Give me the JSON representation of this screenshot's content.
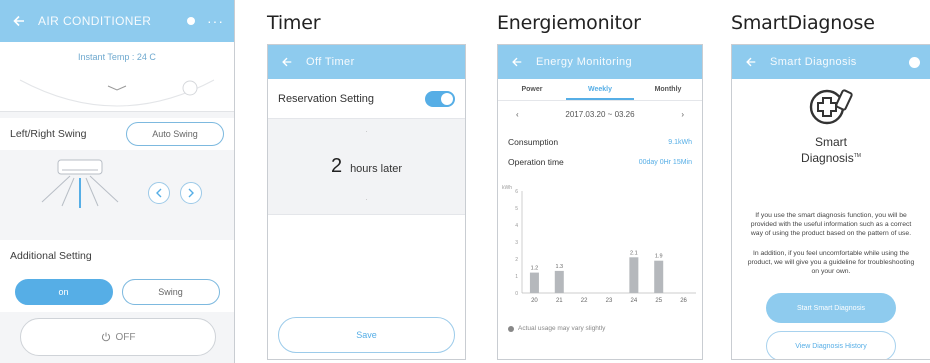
{
  "captions": {
    "timer": "Timer",
    "energy": "Energiemonitor",
    "smart": "SmartDiagnose"
  },
  "colors": {
    "accent": "#56aee6",
    "appbar": "#8ecbee"
  },
  "screen_ac": {
    "title": "AIR CONDITIONER",
    "instant_temp": "Instant Temp : 24 C",
    "swing_label": "Left/Right Swing",
    "auto_swing": "Auto Swing",
    "additional": "Additional Setting",
    "btn_on": "on",
    "btn_swing": "Swing",
    "off": "OFF"
  },
  "screen_timer": {
    "title": "Off Timer",
    "reservation": "Reservation Setting",
    "value": "2",
    "unit": "hours later",
    "save": "Save"
  },
  "screen_energy": {
    "title": "Energy Monitoring",
    "tabs": [
      "Power",
      "Weekly",
      "Monthly"
    ],
    "date_range": "2017.03.20 ~ 03.26",
    "consumption_label": "Consumption",
    "consumption_value": "9.1kWh",
    "operation_label": "Operation time",
    "operation_value": "00day 0Hr 15Min",
    "legend": "Actual usage may vary slightly"
  },
  "chart_data": {
    "type": "bar",
    "categories": [
      "20",
      "21",
      "22",
      "23",
      "24",
      "25",
      "26"
    ],
    "values": [
      1.2,
      1.3,
      0,
      0,
      2.1,
      1.9,
      0
    ],
    "data_labels": [
      "1.2",
      "1.3",
      "",
      "",
      "2.1",
      "1.9",
      ""
    ],
    "ylabel": "kWh",
    "ylim": [
      0,
      6
    ],
    "grid": false
  },
  "screen_smart": {
    "title": "Smart Diagnosis",
    "logo_line1": "Smart",
    "logo_line2": "Diagnosis",
    "tm": "TM",
    "para1": "If you use the smart diagnosis function, you will be provided with the useful information such as a correct way of using the product based on the pattern of use.",
    "para2": "In addition, if you feel uncomfortable while using the product, we will give you a guideline for troubleshooting on your own.",
    "btn_start": "Start Smart Diagnosis",
    "btn_history": "View Diagnosis History"
  }
}
